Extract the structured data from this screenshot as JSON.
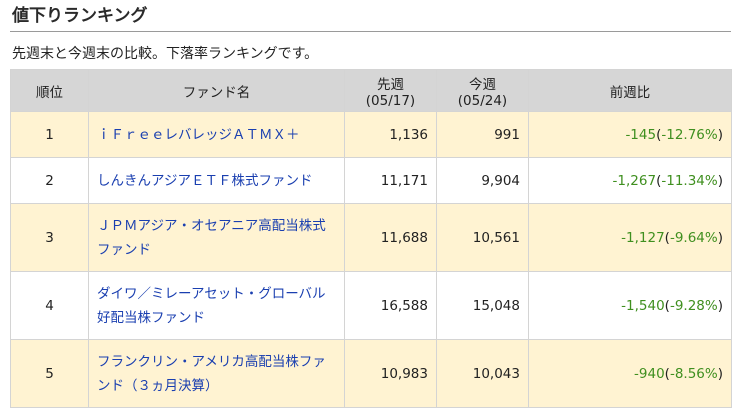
{
  "page": {
    "title": "値下りランキング",
    "description": "先週末と今週末の比較。下落率ランキングです。"
  },
  "table": {
    "headers": {
      "rank": "順位",
      "fund": "ファンド名",
      "prev": "先週(05/17)",
      "curr": "今週(05/24)",
      "change": "前週比"
    },
    "rows": [
      {
        "rank": "1",
        "fund": "ｉＦｒｅｅレバレッジＡＴＭＸ＋",
        "prev": "1,136",
        "curr": "991",
        "diff": "-145",
        "pct": "-12.76%"
      },
      {
        "rank": "2",
        "fund": "しんきんアジアＥＴＦ株式ファンド",
        "prev": "11,171",
        "curr": "9,904",
        "diff": "-1,267",
        "pct": "-11.34%"
      },
      {
        "rank": "3",
        "fund": "ＪＰＭアジア・オセアニア高配当株式ファンド",
        "prev": "11,688",
        "curr": "10,561",
        "diff": "-1,127",
        "pct": "-9.64%"
      },
      {
        "rank": "4",
        "fund": "ダイワ／ミレーアセット・グローバル好配当株ファンド",
        "prev": "16,588",
        "curr": "15,048",
        "diff": "-1,540",
        "pct": "-9.28%"
      },
      {
        "rank": "5",
        "fund": "フランクリン・アメリカ高配当株ファンド（３ヵ月決算）",
        "prev": "10,983",
        "curr": "10,043",
        "diff": "-940",
        "pct": "-8.56%"
      }
    ]
  },
  "colors": {
    "header_bg": "#d6d6d6",
    "odd_row_bg": "#fff3d2",
    "link": "#1a3fb0",
    "negative": "#3f8f1f"
  }
}
